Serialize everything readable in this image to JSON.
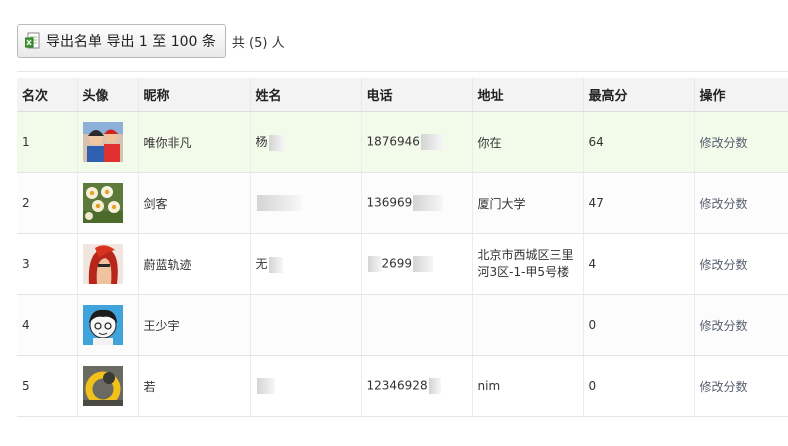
{
  "toolbar": {
    "export_label": "导出名单 导出 1 至 100 条",
    "export_icon": "excel-export-icon",
    "total_label": "共 (5) 人"
  },
  "table": {
    "headers": [
      "名次",
      "头像",
      "昵称",
      "姓名",
      "电话",
      "地址",
      "最高分",
      "操作"
    ],
    "rows": [
      {
        "rank": "1",
        "avatar": "avatar-kids-photo",
        "nickname": "唯你非凡",
        "name": "杨",
        "phone": "1876946",
        "address": "你在",
        "score": "64",
        "action": "修改分数"
      },
      {
        "rank": "2",
        "avatar": "avatar-daffodils-photo",
        "nickname": "剑客",
        "name": "",
        "phone": "136969",
        "address": "厦门大学",
        "score": "47",
        "action": "修改分数"
      },
      {
        "rank": "3",
        "avatar": "avatar-red-hair-anime",
        "nickname": "蔚蓝轨迹",
        "name": "无",
        "phone": "2699",
        "address": "北京市西城区三里河3区-1-甲5号楼",
        "score": "4",
        "action": "修改分数"
      },
      {
        "rank": "4",
        "avatar": "avatar-cartoon-boy",
        "nickname": "王少宇",
        "name": "",
        "phone": "",
        "address": "",
        "score": "0",
        "action": "修改分数"
      },
      {
        "rank": "5",
        "avatar": "avatar-yellow-ring",
        "nickname": "若",
        "name": "",
        "phone": "12346928",
        "address": "nim",
        "score": "0",
        "action": "修改分数"
      }
    ]
  }
}
